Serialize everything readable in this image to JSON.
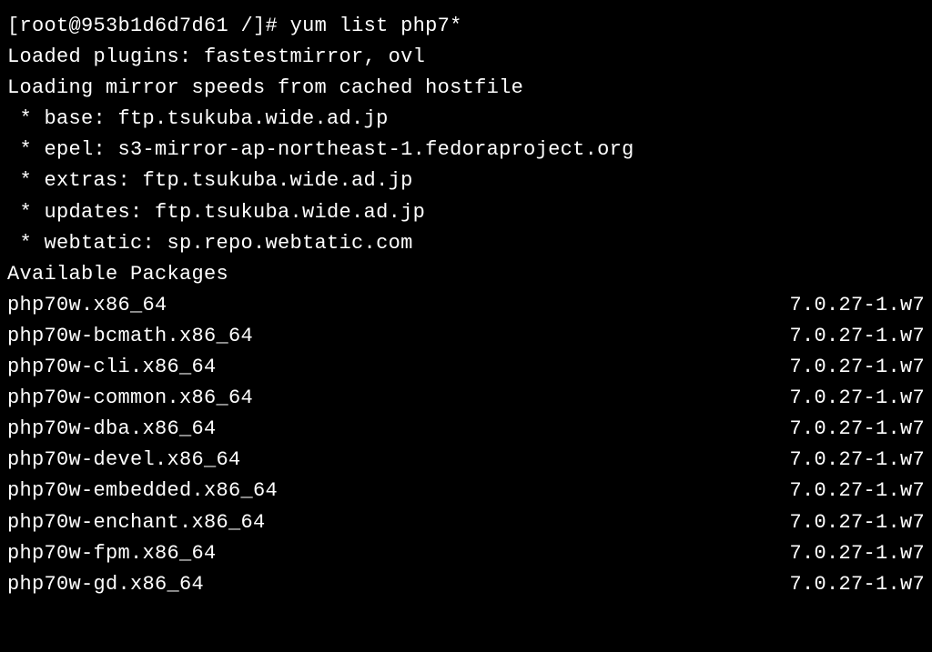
{
  "prompt": {
    "user_host": "[root@953b1d6d7d61 /]#",
    "command": "yum list php7*"
  },
  "plugins_line": "Loaded plugins: fastestmirror, ovl",
  "loading_line": "Loading mirror speeds from cached hostfile",
  "mirrors": [
    " * base: ftp.tsukuba.wide.ad.jp",
    " * epel: s3-mirror-ap-northeast-1.fedoraproject.org",
    " * extras: ftp.tsukuba.wide.ad.jp",
    " * updates: ftp.tsukuba.wide.ad.jp",
    " * webtatic: sp.repo.webtatic.com"
  ],
  "section_header": "Available Packages",
  "packages": [
    {
      "name": "php70w.x86_64",
      "version": "7.0.27-1.w7"
    },
    {
      "name": "php70w-bcmath.x86_64",
      "version": "7.0.27-1.w7"
    },
    {
      "name": "php70w-cli.x86_64",
      "version": "7.0.27-1.w7"
    },
    {
      "name": "php70w-common.x86_64",
      "version": "7.0.27-1.w7"
    },
    {
      "name": "php70w-dba.x86_64",
      "version": "7.0.27-1.w7"
    },
    {
      "name": "php70w-devel.x86_64",
      "version": "7.0.27-1.w7"
    },
    {
      "name": "php70w-embedded.x86_64",
      "version": "7.0.27-1.w7"
    },
    {
      "name": "php70w-enchant.x86_64",
      "version": "7.0.27-1.w7"
    },
    {
      "name": "php70w-fpm.x86_64",
      "version": "7.0.27-1.w7"
    },
    {
      "name": "php70w-gd.x86_64",
      "version": "7.0.27-1.w7"
    }
  ]
}
